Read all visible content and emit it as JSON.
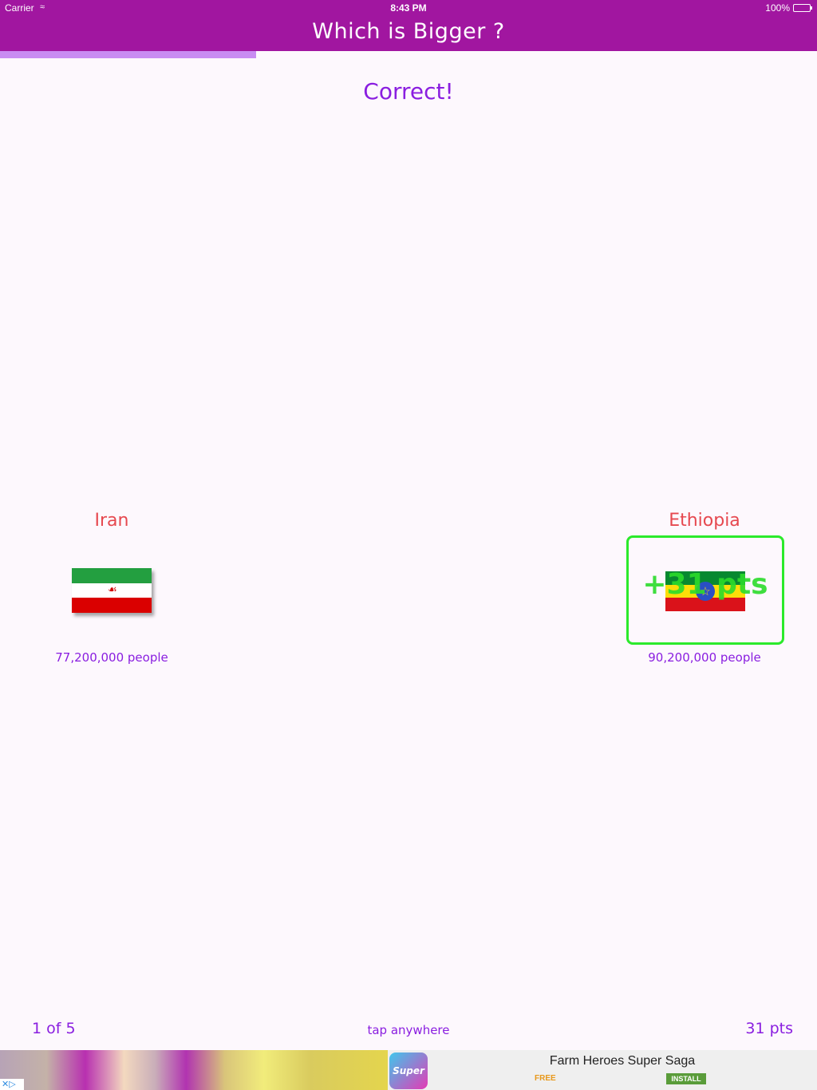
{
  "status_bar": {
    "carrier": "Carrier",
    "time": "8:43 PM",
    "battery": "100%"
  },
  "nav": {
    "title": "Which is Bigger ?"
  },
  "progress": {
    "fraction": 0.3134
  },
  "result_message": "Correct!",
  "countries": {
    "left": {
      "name": "Iran",
      "population": "77,200,000 people",
      "flag_colors": [
        "#239f40",
        "#ffffff",
        "#da0000"
      ]
    },
    "right": {
      "name": "Ethiopia",
      "population": "90,200,000 people",
      "flag_colors": [
        "#078930",
        "#fcdd09",
        "#da121a"
      ],
      "points_earned": "+31 pts",
      "selected": true
    }
  },
  "footer": {
    "counter": "1 of 5",
    "hint": "tap anywhere",
    "score": "31 pts"
  },
  "ad": {
    "title": "Farm Heroes Super Saga",
    "price": "FREE",
    "install_label": "INSTALL",
    "icon_text": "Super"
  },
  "colors": {
    "brand": "#a116a0",
    "accent_text": "#8a1ee0",
    "country_name": "#e6484f",
    "correct_highlight": "#2bea2b"
  }
}
